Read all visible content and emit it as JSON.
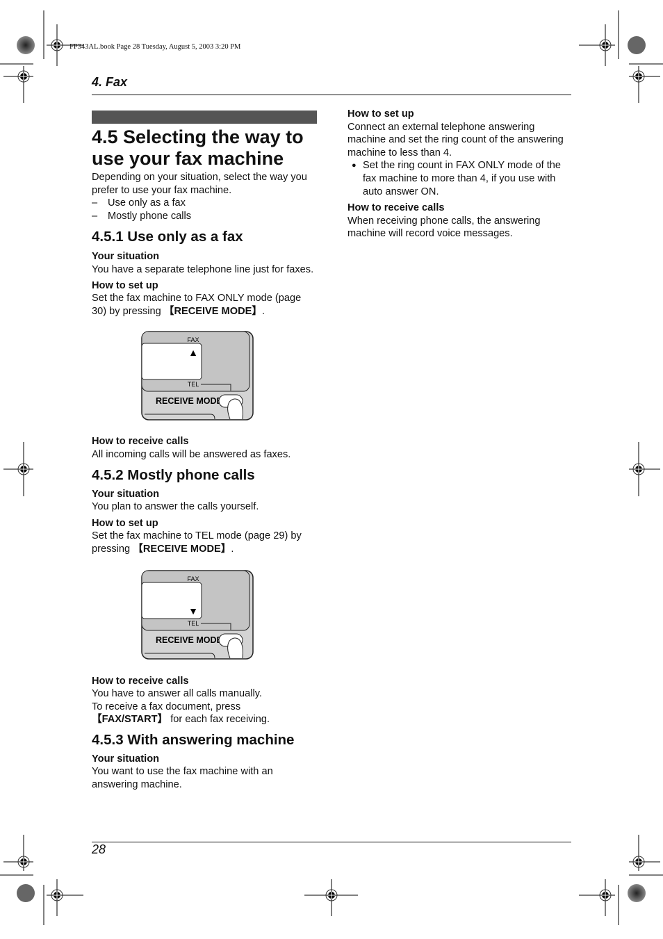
{
  "slug": "FP343AL.book  Page 28  Tuesday, August 5, 2003  3:20 PM",
  "chapter": "4. Fax",
  "page_number": "28",
  "left": {
    "title_line1": "4.5 Selecting the way to",
    "title_line2": "use your fax machine",
    "intro": "Depending on your situation, select the way you prefer to use your fax machine.",
    "options": [
      {
        "dash": "–",
        "text": "Use only as a fax"
      },
      {
        "dash": "–",
        "text": "Mostly phone calls"
      }
    ],
    "s1": {
      "heading": "4.5.1 Use only as a fax",
      "situation_label": "Your situation",
      "situation_text": "You have a separate telephone line just for faxes.",
      "setup_label": "How to set up",
      "setup_text": "Set the fax machine to FAX ONLY mode (page 30) by pressing ",
      "setup_key": "【RECEIVE MODE】",
      "setup_end": ".",
      "receive_label": "How to receive calls",
      "receive_text": "All incoming calls will be answered as faxes."
    },
    "s2": {
      "heading": "4.5.2 Mostly phone calls",
      "situation_label": "Your situation",
      "situation_text": "You plan to answer the calls yourself.",
      "setup_label": "How to set up",
      "setup_text": "Set the fax machine to TEL mode (page 29) by pressing ",
      "setup_key": "【RECEIVE MODE】",
      "setup_end": ".",
      "receive_label": "How to receive calls",
      "receive_text1": "You have to answer all calls manually.",
      "receive_text2": "To receive a fax document, press ",
      "receive_key": "【FAX/START】",
      "receive_text3": " for each fax receiving."
    },
    "s3": {
      "heading": "4.5.3 With answering machine",
      "situation_label": "Your situation",
      "situation_text": "You want to use the fax machine with an answering machine."
    }
  },
  "panel": {
    "fax_label": "FAX",
    "tel_label": "TEL",
    "button_label": "RECEIVE MODE",
    "fig1_indicator": "▲",
    "fig2_indicator": "▼"
  },
  "right": {
    "setup_label": "How to set up",
    "setup_text": "Connect an external telephone answering machine and set the ring count of the answering machine to less than 4.",
    "bullet": "●",
    "bullet_text": "Set the ring count in FAX ONLY mode of the fax machine to more than 4, if you use with auto answer ON.",
    "receive_label": "How to receive calls",
    "receive_text": "When receiving phone calls, the answering machine will record voice messages."
  }
}
